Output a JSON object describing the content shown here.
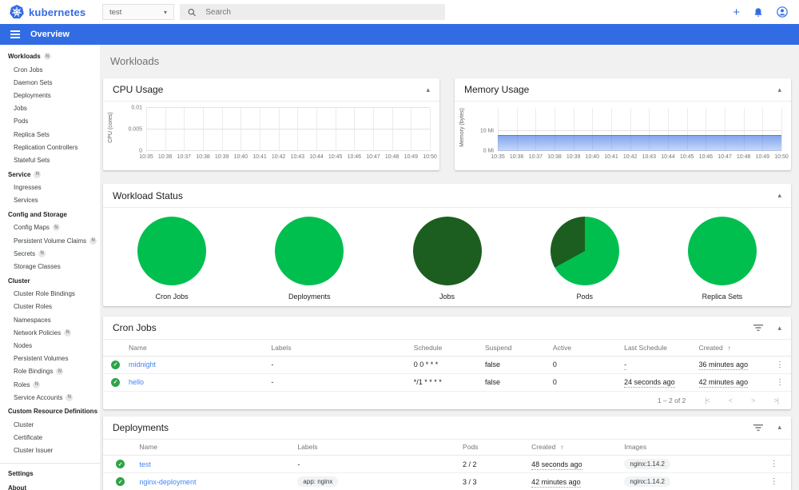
{
  "colors": {
    "brand_blue": "#326ce5",
    "link_blue": "#4285f4",
    "success_light_green": "#00bf4f",
    "success_dark_green": "#1b5e20",
    "check_icon_green": "#2da448"
  },
  "topbar": {
    "logo_text": "kubernetes",
    "namespace": {
      "value": "test"
    },
    "search_placeholder": "Search",
    "actions": [
      {
        "name": "create",
        "icon": "plus-icon"
      },
      {
        "name": "notifications",
        "icon": "bell-icon"
      },
      {
        "name": "account",
        "icon": "user-icon"
      }
    ]
  },
  "navbar": {
    "title": "Overview"
  },
  "sidebar": {
    "groups": [
      {
        "label": "Workloads",
        "badge": "N",
        "items": [
          {
            "label": "Cron Jobs"
          },
          {
            "label": "Daemon Sets"
          },
          {
            "label": "Deployments"
          },
          {
            "label": "Jobs"
          },
          {
            "label": "Pods"
          },
          {
            "label": "Replica Sets"
          },
          {
            "label": "Replication Controllers"
          },
          {
            "label": "Stateful Sets"
          }
        ]
      },
      {
        "label": "Service",
        "badge": "N",
        "items": [
          {
            "label": "Ingresses"
          },
          {
            "label": "Services"
          }
        ]
      },
      {
        "label": "Config and Storage",
        "items": [
          {
            "label": "Config Maps",
            "badge": "N"
          },
          {
            "label": "Persistent Volume Claims",
            "badge": "N"
          },
          {
            "label": "Secrets",
            "badge": "N"
          },
          {
            "label": "Storage Classes"
          }
        ]
      },
      {
        "label": "Cluster",
        "items": [
          {
            "label": "Cluster Role Bindings"
          },
          {
            "label": "Cluster Roles"
          },
          {
            "label": "Namespaces"
          },
          {
            "label": "Network Policies",
            "badge": "N"
          },
          {
            "label": "Nodes"
          },
          {
            "label": "Persistent Volumes"
          },
          {
            "label": "Role Bindings",
            "badge": "N"
          },
          {
            "label": "Roles",
            "badge": "N"
          },
          {
            "label": "Service Accounts",
            "badge": "N"
          }
        ]
      },
      {
        "label": "Custom Resource Definitions",
        "items": [
          {
            "label": "Cluster"
          },
          {
            "label": "Certificate"
          },
          {
            "label": "Cluster Issuer"
          }
        ]
      }
    ],
    "footer_items": [
      "Settings",
      "About"
    ]
  },
  "main": {
    "page_title": "Workloads"
  },
  "chart_data": [
    {
      "type": "line",
      "title": "CPU Usage",
      "ylabel": "CPU (cores)",
      "x": [
        "10:35",
        "10:36",
        "10:37",
        "10:38",
        "10:39",
        "10:40",
        "10:41",
        "10:42",
        "10:43",
        "10:44",
        "10:45",
        "10:46",
        "10:47",
        "10:48",
        "10:49",
        "10:50"
      ],
      "yticks": [
        {
          "value": 0,
          "label": "0"
        },
        {
          "value": 0.005,
          "label": "0.005"
        },
        {
          "value": 0.01,
          "label": "0.01"
        }
      ],
      "ylim": [
        0,
        0.01
      ],
      "grid": true,
      "series": []
    },
    {
      "type": "area",
      "title": "Memory Usage",
      "ylabel": "Memory (bytes)",
      "x": [
        "10:35",
        "10:36",
        "10:37",
        "10:38",
        "10:39",
        "10:40",
        "10:41",
        "10:42",
        "10:43",
        "10:44",
        "10:45",
        "10:46",
        "10:47",
        "10:48",
        "10:49",
        "10:50"
      ],
      "yticks": [
        {
          "value": 0,
          "label": "0 Mi"
        },
        {
          "value": 10,
          "label": "10 Mi"
        }
      ],
      "ylim": [
        0,
        21.5
      ],
      "grid": true,
      "series": [
        {
          "name": "memory usage (Mi)",
          "values": [
            7.8,
            7.8,
            7.8,
            7.8,
            7.8,
            7.8,
            7.8,
            7.8,
            7.8,
            7.8,
            7.8,
            7.8,
            7.8,
            7.8,
            7.8,
            7.8
          ]
        }
      ]
    },
    {
      "type": "pie",
      "title": "Workload Status",
      "pies": [
        {
          "label": "Cron Jobs",
          "segments": [
            {
              "name": "ready",
              "color": "#00bf4f",
              "pct": 100
            }
          ]
        },
        {
          "label": "Deployments",
          "segments": [
            {
              "name": "ready",
              "color": "#00bf4f",
              "pct": 100
            }
          ]
        },
        {
          "label": "Jobs",
          "segments": [
            {
              "name": "succeeded",
              "color": "#1b5e20",
              "pct": 100
            }
          ]
        },
        {
          "label": "Pods",
          "segments": [
            {
              "name": "running",
              "color": "#00bf4f",
              "pct": 67
            },
            {
              "name": "succeeded",
              "color": "#1b5e20",
              "pct": 33
            }
          ]
        },
        {
          "label": "Replica Sets",
          "segments": [
            {
              "name": "ready",
              "color": "#00bf4f",
              "pct": 100
            }
          ]
        }
      ]
    }
  ],
  "tables": {
    "cron_jobs": {
      "title": "Cron Jobs",
      "columns": [
        {
          "label": ""
        },
        {
          "label": "Name"
        },
        {
          "label": "Labels"
        },
        {
          "label": "Schedule"
        },
        {
          "label": "Suspend"
        },
        {
          "label": "Active"
        },
        {
          "label": "Last Schedule"
        },
        {
          "label": "Created",
          "sorted": true
        },
        {
          "label": ""
        }
      ],
      "rows": [
        [
          {
            "type": "status-ok"
          },
          {
            "type": "link",
            "text": "midnight"
          },
          {
            "type": "text",
            "text": "-"
          },
          {
            "type": "text",
            "text": "0 0 * * *"
          },
          {
            "type": "text",
            "text": "false"
          },
          {
            "type": "text",
            "text": "0"
          },
          {
            "type": "dashed",
            "text": "-"
          },
          {
            "type": "dashed",
            "text": "36 minutes ago"
          },
          {
            "type": "menu"
          }
        ],
        [
          {
            "type": "status-ok"
          },
          {
            "type": "link",
            "text": "hello"
          },
          {
            "type": "text",
            "text": "-"
          },
          {
            "type": "text",
            "text": "*/1 * * * *"
          },
          {
            "type": "text",
            "text": "false"
          },
          {
            "type": "text",
            "text": "0"
          },
          {
            "type": "dashed",
            "text": "24 seconds ago"
          },
          {
            "type": "dashed",
            "text": "42 minutes ago"
          },
          {
            "type": "menu"
          }
        ]
      ],
      "pagination": {
        "range": "1 – 2 of 2",
        "buttons": [
          "first-page",
          "previous-page",
          "next-page",
          "last-page"
        ]
      }
    },
    "deployments": {
      "title": "Deployments",
      "columns": [
        {
          "label": ""
        },
        {
          "label": "Name"
        },
        {
          "label": "Labels"
        },
        {
          "label": "Pods"
        },
        {
          "label": "Created",
          "sorted": true
        },
        {
          "label": "Images"
        },
        {
          "label": ""
        }
      ],
      "rows": [
        [
          {
            "type": "status-ok"
          },
          {
            "type": "link",
            "text": "test"
          },
          {
            "type": "text",
            "text": "-"
          },
          {
            "type": "text",
            "text": "2 / 2"
          },
          {
            "type": "dashed",
            "text": "48 seconds ago"
          },
          {
            "type": "chip",
            "text": "nginx:1.14.2"
          },
          {
            "type": "menu"
          }
        ],
        [
          {
            "type": "status-ok"
          },
          {
            "type": "link",
            "text": "nginx-deployment"
          },
          {
            "type": "chip",
            "text": "app: nginx"
          },
          {
            "type": "text",
            "text": "3 / 3"
          },
          {
            "type": "dashed",
            "text": "42 minutes ago"
          },
          {
            "type": "chip",
            "text": "nginx:1.14.2"
          },
          {
            "type": "menu"
          }
        ]
      ]
    }
  }
}
